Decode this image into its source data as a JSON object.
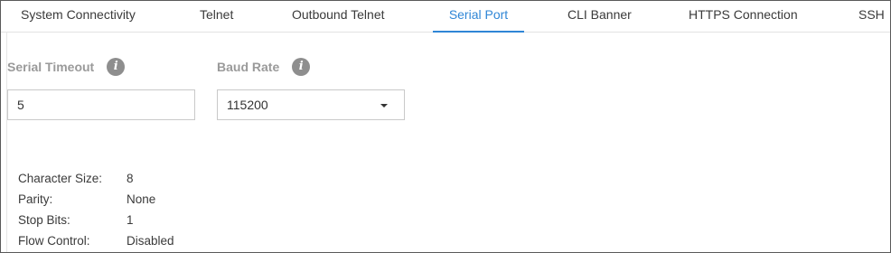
{
  "tabs": [
    {
      "label": "System Connectivity",
      "active": false
    },
    {
      "label": "Telnet",
      "active": false
    },
    {
      "label": "Outbound Telnet",
      "active": false
    },
    {
      "label": "Serial Port",
      "active": true
    },
    {
      "label": "CLI Banner",
      "active": false
    },
    {
      "label": "HTTPS Connection",
      "active": false
    },
    {
      "label": "SSH",
      "active": false
    }
  ],
  "serial_timeout": {
    "label": "Serial Timeout",
    "value": "5",
    "icon": "info-icon"
  },
  "baud_rate": {
    "label": "Baud Rate",
    "value": "115200",
    "icon": "info-icon"
  },
  "details": [
    {
      "key": "Character Size:",
      "value": "8"
    },
    {
      "key": "Parity:",
      "value": "None"
    },
    {
      "key": "Stop Bits:",
      "value": "1"
    },
    {
      "key": "Flow Control:",
      "value": "Disabled"
    }
  ],
  "colors": {
    "accent": "#2f86d6"
  }
}
